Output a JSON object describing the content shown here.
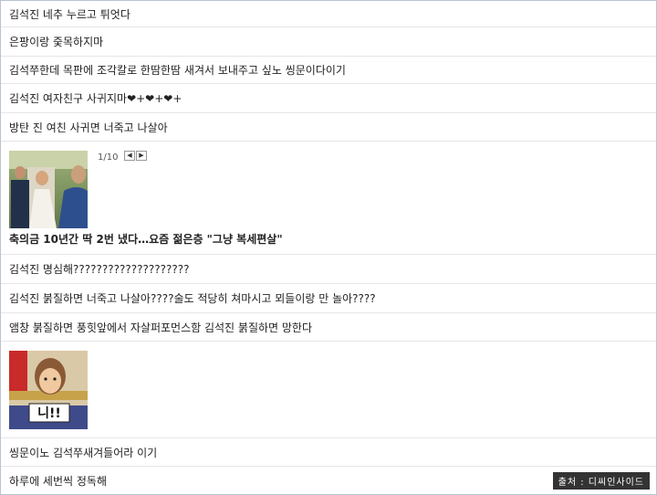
{
  "comments": [
    {
      "text": "김석진 네추 누르고 튀엇다"
    },
    {
      "text": "은팡이랑 줒목하지마"
    },
    {
      "text": "김석쭈한데 목판에 조각칼로 한땀한땀 새겨서 보내주고 싶노 씽문이다이기"
    },
    {
      "text": "김석진 여자친구 사귀지마❤+❤+❤+"
    },
    {
      "text": "방탄 진 여친 사귀면 너죽고 나살아"
    }
  ],
  "article": {
    "image": "wedding-photo",
    "counter": "1/10",
    "prev_icon": "triangle-left-icon",
    "next_icon": "triangle-right-icon",
    "headline": "축의금 10년간 딱 2번 냈다…요즘 젊은층 \"그냥 복세편살\""
  },
  "comments2": [
    {
      "text": "김석진 명심해????????????????????"
    },
    {
      "text": "김석진 붉질하면 너죽고 나살아????술도 적당히 쳐마시고 뫼들이랑 만 놀아????"
    },
    {
      "text": "앰창 붉질하면 풍힛앞에서 자살퍼포먼스함 김석진 붉질하면 망한다"
    }
  ],
  "sticker": {
    "caption": "니!!"
  },
  "comments3": [
    {
      "text": "씽문이노 김석쭈새겨들어라 이기"
    },
    {
      "text": "하루에 세번씩 정독해"
    }
  ],
  "source_label": "출처 : 디씨인사이드",
  "colors": {
    "border": "#b9c3d3",
    "divider": "#e6e6e6",
    "source_bg": "#333333"
  }
}
